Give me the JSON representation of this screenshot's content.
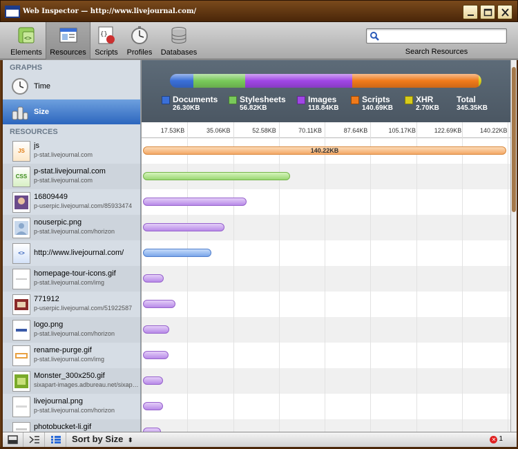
{
  "window": {
    "title": "Web Inspector — http://www.livejournal.com/"
  },
  "toolbar": {
    "items": [
      {
        "label": "Elements",
        "icon": "elements-icon"
      },
      {
        "label": "Resources",
        "icon": "resources-icon"
      },
      {
        "label": "Scripts",
        "icon": "scripts-icon"
      },
      {
        "label": "Profiles",
        "icon": "profiles-icon"
      },
      {
        "label": "Databases",
        "icon": "databases-icon"
      }
    ],
    "selected": "Resources",
    "search": {
      "value": "",
      "label": "Search Resources"
    }
  },
  "sidebar": {
    "graphs_header": "GRAPHS",
    "graphs": [
      {
        "label": "Time",
        "icon": "clock-icon"
      },
      {
        "label": "Size",
        "icon": "size-icon",
        "selected": true
      }
    ],
    "resources_header": "RESOURCES",
    "resources": [
      {
        "name": "js",
        "domain": "p-stat.livejournal.com",
        "type": "js",
        "icon_text": "JS"
      },
      {
        "name": "p-stat.livejournal.com",
        "domain": "p-stat.livejournal.com",
        "type": "css",
        "icon_text": "CSS"
      },
      {
        "name": "16809449",
        "domain": "p-userpic.livejournal.com/85933474",
        "type": "img"
      },
      {
        "name": "nouserpic.png",
        "domain": "p-stat.livejournal.com/horizon",
        "type": "img"
      },
      {
        "name": "http://www.livejournal.com/",
        "domain": "",
        "type": "doc",
        "icon_text": "<>"
      },
      {
        "name": "homepage-tour-icons.gif",
        "domain": "p-stat.livejournal.com/img",
        "type": "img"
      },
      {
        "name": "771912",
        "domain": "p-userpic.livejournal.com/51922587",
        "type": "img"
      },
      {
        "name": "logo.png",
        "domain": "p-stat.livejournal.com/horizon",
        "type": "img"
      },
      {
        "name": "rename-purge.gif",
        "domain": "p-stat.livejournal.com/img",
        "type": "img"
      },
      {
        "name": "Monster_300x250.gif",
        "domain": "sixapart-images.adbureau.net/sixapart",
        "type": "img"
      },
      {
        "name": "livejournal.png",
        "domain": "p-stat.livejournal.com/horizon",
        "type": "img"
      },
      {
        "name": "photobucket-li.gif",
        "domain": "",
        "type": "img"
      }
    ]
  },
  "summary": {
    "categories": [
      {
        "name": "Documents",
        "size": "26.30KB",
        "kb": 26.3,
        "color": "#3a6fd8"
      },
      {
        "name": "Stylesheets",
        "size": "56.82KB",
        "kb": 56.82,
        "color": "#79c95a"
      },
      {
        "name": "Images",
        "size": "118.84KB",
        "kb": 118.84,
        "color": "#a046e6"
      },
      {
        "name": "Scripts",
        "size": "140.69KB",
        "kb": 140.69,
        "color": "#f07a1a"
      },
      {
        "name": "XHR",
        "size": "2.70KB",
        "kb": 2.7,
        "color": "#d8cc1a"
      }
    ],
    "total_label": "Total",
    "total": "345.35KB",
    "track_color": "#4a5460"
  },
  "ruler": {
    "ticks": [
      "17.53KB",
      "35.06KB",
      "52.58KB",
      "70.11KB",
      "87.64KB",
      "105.17KB",
      "122.69KB",
      "140.22KB"
    ],
    "max_kb": 140.22
  },
  "timeline": {
    "bars": [
      {
        "type": "js",
        "kb": 140.22,
        "label": "140.22KB"
      },
      {
        "type": "css",
        "kb": 56.82
      },
      {
        "type": "img",
        "kb": 40.0
      },
      {
        "type": "img",
        "kb": 31.5
      },
      {
        "type": "doc",
        "kb": 26.3
      },
      {
        "type": "img",
        "kb": 8.0
      },
      {
        "type": "img",
        "kb": 12.5
      },
      {
        "type": "img",
        "kb": 10.0
      },
      {
        "type": "img",
        "kb": 9.8
      },
      {
        "type": "img",
        "kb": 7.7
      },
      {
        "type": "img",
        "kb": 7.7
      },
      {
        "type": "img",
        "kb": 7.0
      }
    ]
  },
  "statusbar": {
    "sort_label": "Sort by Size",
    "error_count": "1"
  }
}
